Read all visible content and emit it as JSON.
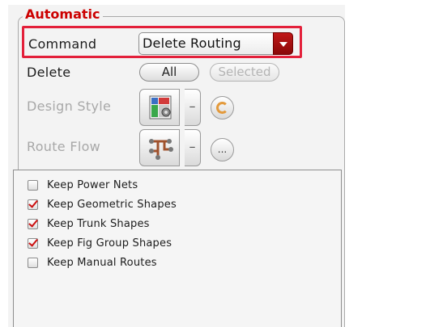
{
  "group": {
    "title": "Automatic"
  },
  "command": {
    "label": "Command",
    "value": "Delete Routing"
  },
  "delete": {
    "label": "Delete",
    "all_label": "All",
    "selected_label": "Selected"
  },
  "design_style": {
    "label": "Design Style"
  },
  "route_flow": {
    "label": "Route Flow",
    "more_label": "..."
  },
  "options": [
    {
      "label": "Keep Power Nets",
      "checked": false
    },
    {
      "label": "Keep Geometric Shapes",
      "checked": true
    },
    {
      "label": "Keep Trunk Shapes",
      "checked": true
    },
    {
      "label": "Keep Fig Group Shapes",
      "checked": true
    },
    {
      "label": "Keep Manual Routes",
      "checked": false
    }
  ],
  "colors": {
    "accent": "#cc0000",
    "highlight": "#e3203a",
    "dropdown": "#a81010",
    "disabled": "#a8a8a8"
  },
  "icons": {
    "dropdown": "chevron-down-icon",
    "design_style": "design-style-icon",
    "route_flow": "route-flow-icon",
    "refresh": "refresh-icon"
  }
}
